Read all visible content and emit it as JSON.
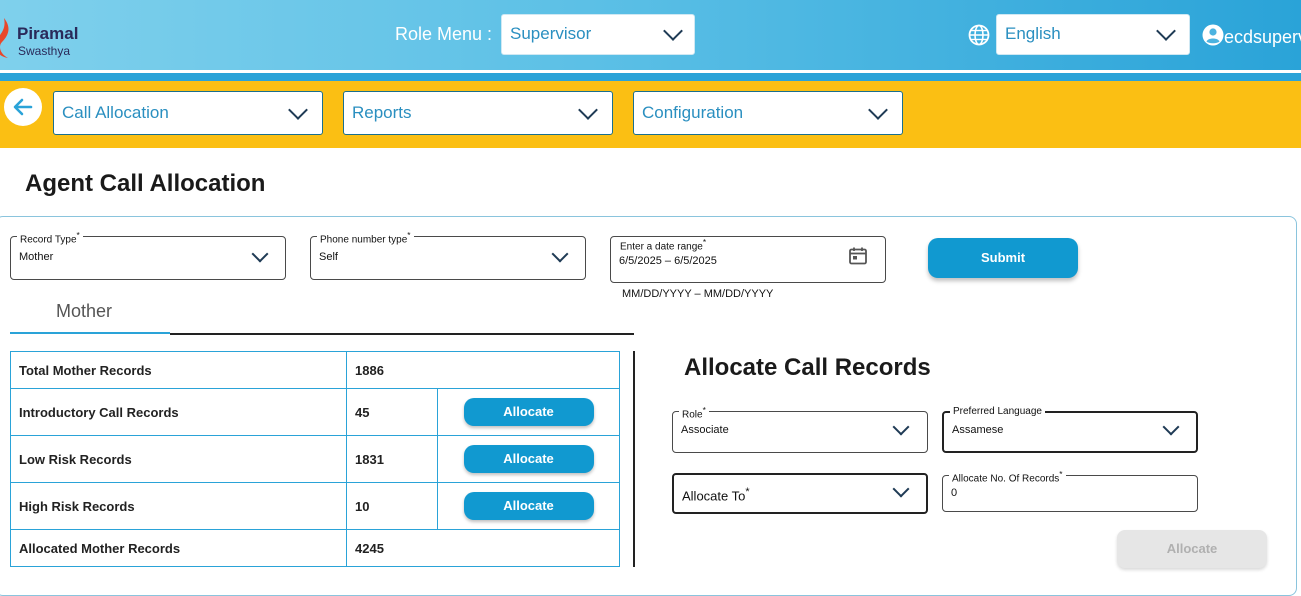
{
  "brand": {
    "title": "Piramal",
    "subtitle": "Swasthya"
  },
  "header": {
    "role_menu_label": "Role Menu :",
    "role_value": "Supervisor",
    "language_value": "English",
    "username": "ecdsuperv"
  },
  "nav": {
    "items": [
      {
        "label": "Call Allocation"
      },
      {
        "label": "Reports"
      },
      {
        "label": "Configuration"
      }
    ]
  },
  "page": {
    "title": "Agent Call Allocation"
  },
  "filters": {
    "record_type": {
      "label": "Record Type",
      "required_mark": "*",
      "value": "Mother"
    },
    "phone_number_type": {
      "label": "Phone number type",
      "required_mark": "*",
      "value": "Self"
    },
    "date_range": {
      "label": "Enter a date range",
      "required_mark": "*",
      "start": "6/5/2025",
      "separator": "–",
      "end": "6/5/2025",
      "hint": "MM/DD/YYYY – MM/DD/YYYY"
    },
    "submit_label": "Submit"
  },
  "tab": {
    "label": "Mother"
  },
  "records": {
    "rows": [
      {
        "label": "Total Mother Records",
        "value": "1886",
        "button": ""
      },
      {
        "label": "Introductory Call Records",
        "value": "45",
        "button": "Allocate"
      },
      {
        "label": "Low Risk Records",
        "value": "1831",
        "button": "Allocate"
      },
      {
        "label": "High Risk Records",
        "value": "10",
        "button": "Allocate"
      },
      {
        "label": "Allocated Mother Records",
        "value": "4245",
        "button": ""
      }
    ]
  },
  "allocate": {
    "title": "Allocate Call Records",
    "role": {
      "label": "Role",
      "required_mark": "*",
      "value": "Associate"
    },
    "preferred_language": {
      "label": "Preferred Language",
      "value": "Assamese"
    },
    "allocate_to": {
      "placeholder": "Allocate To",
      "required_mark": "*"
    },
    "allocate_count": {
      "label": "Allocate No. Of Records",
      "required_mark": "*",
      "value": "0"
    },
    "button_label": "Allocate"
  },
  "colors": {
    "accent": "#1199d0",
    "nav_bar": "#fbbf13",
    "text_link": "#2a8fc0"
  }
}
